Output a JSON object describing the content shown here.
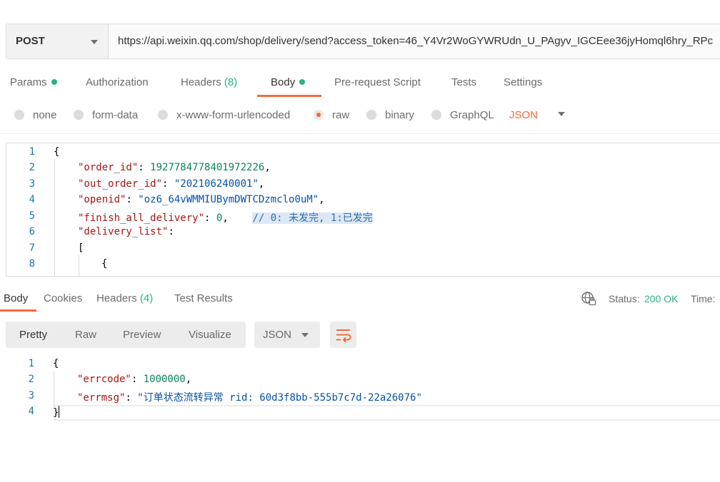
{
  "request": {
    "method": "POST",
    "url": "https://api.weixin.qq.com/shop/delivery/send?access_token=46_Y4Vr2WoGYWRUdn_U_PAgyv_IGCEee36jyHomql6hry_RPc"
  },
  "request_tabs": [
    {
      "label": "Params",
      "dot": true
    },
    {
      "label": "Authorization"
    },
    {
      "label": "Headers",
      "count": "(8)"
    },
    {
      "label": "Body",
      "dot": true,
      "active": true
    },
    {
      "label": "Pre-request Script"
    },
    {
      "label": "Tests"
    },
    {
      "label": "Settings"
    }
  ],
  "body_types": [
    "none",
    "form-data",
    "x-www-form-urlencoded",
    "raw",
    "binary",
    "GraphQL"
  ],
  "body_type_selected": "raw",
  "body_format": "JSON",
  "request_body_lines": [
    {
      "n": "1",
      "text": "{"
    },
    {
      "n": "2",
      "key": "\"order_id\"",
      "val": "1927784778401972226",
      "tail": ","
    },
    {
      "n": "3",
      "key": "\"out_order_id\"",
      "str": "\"202106240001\"",
      "tail": ","
    },
    {
      "n": "4",
      "key": "\"openid\"",
      "str": "\"oz6_64vWMMIUBymDWTCDzmclo0uM\"",
      "tail": ","
    },
    {
      "n": "5",
      "key": "\"finish_all_delivery\"",
      "val": "0",
      "tail": ",",
      "comment": "// 0: 未发完, 1:已发完"
    },
    {
      "n": "6",
      "key": "\"delivery_list\"",
      "tail": ":"
    },
    {
      "n": "7",
      "text": "["
    },
    {
      "n": "8",
      "text": "{"
    }
  ],
  "response_tabs": [
    {
      "label": "Body",
      "active": true
    },
    {
      "label": "Cookies"
    },
    {
      "label": "Headers",
      "count": "(4)"
    },
    {
      "label": "Test Results"
    }
  ],
  "response_status": {
    "label": "Status:",
    "value": "200 OK",
    "time_label": "Time:"
  },
  "view_modes": [
    "Pretty",
    "Raw",
    "Preview",
    "Visualize"
  ],
  "response_format": "JSON",
  "response_body_lines": [
    {
      "n": "1",
      "text": "{"
    },
    {
      "n": "2",
      "key": "\"errcode\"",
      "val": "1000000",
      "tail": ","
    },
    {
      "n": "3",
      "key": "\"errmsg\"",
      "str": "\"订单状态流转异常 rid: 60d3f8bb-555b7c7d-22a26076\""
    },
    {
      "n": "4",
      "text": "}"
    }
  ],
  "colors": {
    "accent": "#f26b3a",
    "success": "#26b47f"
  }
}
